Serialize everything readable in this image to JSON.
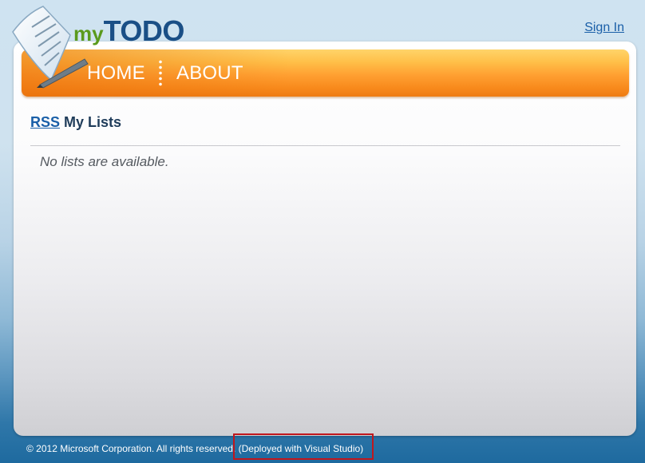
{
  "header": {
    "sign_in": "Sign In",
    "logo": {
      "my": "my",
      "todo": "TODO"
    }
  },
  "nav": {
    "items": [
      {
        "label": "HOME"
      },
      {
        "label": "ABOUT"
      }
    ]
  },
  "main": {
    "rss_link": "RSS",
    "title": "My Lists",
    "empty_message": "No lists are available."
  },
  "footer": {
    "copyright": "© 2012 Microsoft Corporation. All rights reserved.",
    "deployed": "(Deployed with Visual Studio)"
  },
  "colors": {
    "accent_orange": "#f98b1d",
    "link_blue": "#1a5fa8",
    "logo_green": "#5a9a1c",
    "logo_blue": "#1a4f86",
    "highlight_red": "#c0171d"
  },
  "icons": [
    "notepad-pen-icon"
  ]
}
